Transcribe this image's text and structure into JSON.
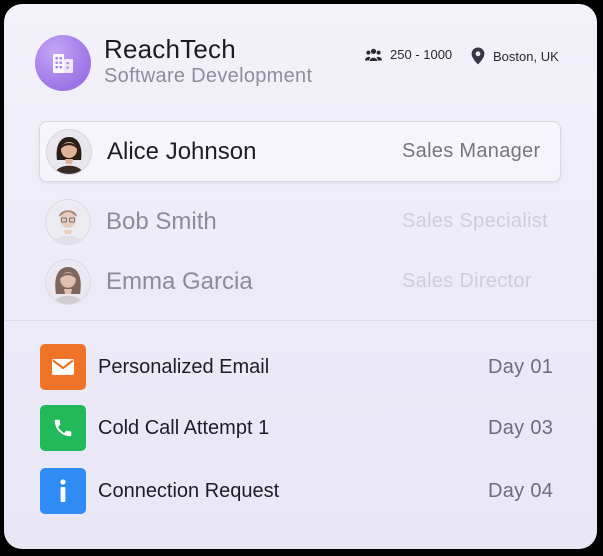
{
  "company": {
    "name": "ReachTech",
    "industry": "Software Development",
    "size": "250 - 1000",
    "location": "Boston, UK",
    "logo_icon": "building-icon",
    "logo_color": "#a47ee9"
  },
  "contacts": [
    {
      "name": "Alice Johnson",
      "role": "Sales Manager",
      "selected": true
    },
    {
      "name": "Bob Smith",
      "role": "Sales Specialist",
      "selected": false
    },
    {
      "name": "Emma Garcia",
      "role": "Sales Director",
      "selected": false
    }
  ],
  "steps": [
    {
      "label": "Personalized Email",
      "day": "Day 01",
      "icon": "mail-icon",
      "color": "#ef7326"
    },
    {
      "label": "Cold Call Attempt 1",
      "day": "Day 03",
      "icon": "phone-icon",
      "color": "#22b95a"
    },
    {
      "label": "Connection Request",
      "day": "Day 04",
      "icon": "info-icon",
      "color": "#2f8cf5"
    }
  ]
}
